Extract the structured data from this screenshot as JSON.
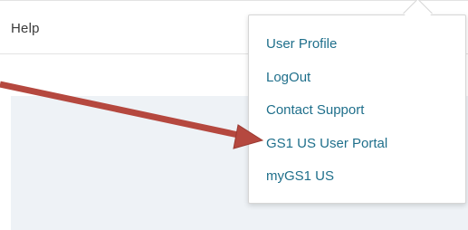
{
  "header": {
    "help_label": "Help"
  },
  "user_menu": {
    "items": [
      {
        "label": "User Profile"
      },
      {
        "label": "LogOut"
      },
      {
        "label": "Contact Support"
      },
      {
        "label": "GS1 US User Portal"
      },
      {
        "label": "myGS1 US"
      }
    ]
  },
  "colors": {
    "menu_link": "#1f6f8b",
    "annotation_arrow": "#b5483f",
    "content_panel": "#eef2f6"
  },
  "annotation": {
    "icon": "arrow-pointer-icon",
    "target": "GS1 US User Portal"
  }
}
